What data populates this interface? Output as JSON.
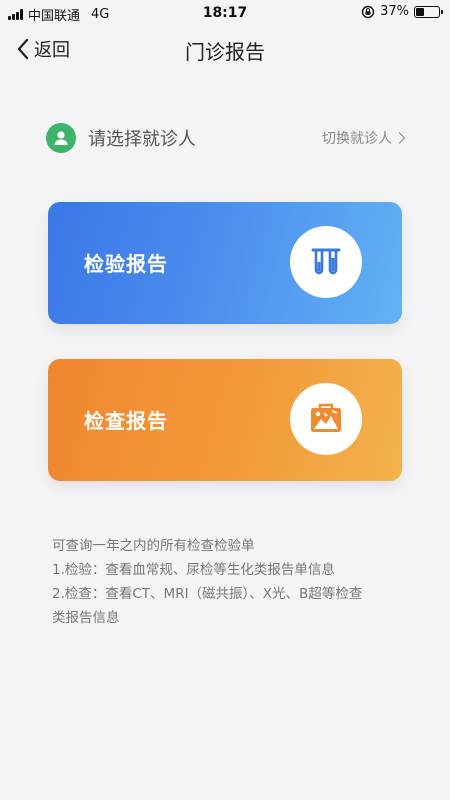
{
  "status_bar": {
    "carrier": "中国联通",
    "network": "4G",
    "time": "18:17",
    "battery": "37%",
    "battery_level": 0.37
  },
  "nav": {
    "back_label": "返回",
    "title": "门诊报告"
  },
  "patient": {
    "prompt": "请选择就诊人",
    "switch_label": "切换就诊人",
    "avatar_color": "#3eb36a"
  },
  "cards": {
    "lab": {
      "label": "检验报告",
      "icon": "test-tubes-icon",
      "color": "#3a76e6",
      "icon_color": "#3a78e0"
    },
    "exam": {
      "label": "检查报告",
      "icon": "medical-image-icon",
      "color": "#f0862e",
      "icon_color": "#f08a30"
    }
  },
  "notes": {
    "line1": "可查询一年之内的所有检查检验单",
    "line2": "1.检验：查看血常规、尿检等生化类报告单信息",
    "line3": "2.检查：查看CT、MRI（磁共振）、X光、B超等检查",
    "line4": "类报告信息"
  }
}
